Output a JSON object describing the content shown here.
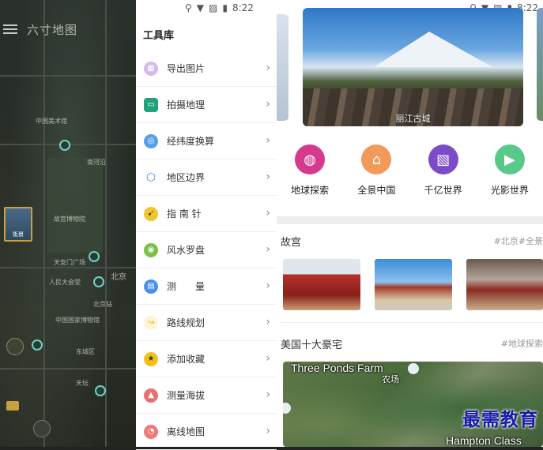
{
  "status_bar": {
    "time": "8:22"
  },
  "map": {
    "title": "六寸地图",
    "thumb_label": "街景",
    "place_labels": [
      "中国美术馆",
      "故宫博物院",
      "天安门广场",
      "北京",
      "人民大会堂",
      "北京站",
      "天坛",
      "南河沿",
      "东城区",
      "中国国家博物馆"
    ]
  },
  "toolbox": {
    "title": "工具库",
    "items": [
      {
        "label": "导出图片",
        "icon": "image-export-icon",
        "color": "#d5b8ee"
      },
      {
        "label": "拍摄地理",
        "icon": "camera-geo-icon",
        "color": "#1fa37a"
      },
      {
        "label": "经纬度换算",
        "icon": "latlng-convert-icon",
        "color": "#5aa0e6"
      },
      {
        "label": "地区边界",
        "icon": "boundary-icon",
        "color": "#3a8fd8"
      },
      {
        "label": "指 南 针",
        "icon": "compass-icon",
        "color": "#f2c530"
      },
      {
        "label": "风水罗盘",
        "icon": "fengshui-compass-icon",
        "color": "#7cc04a"
      },
      {
        "label": "测　　量",
        "icon": "measure-icon",
        "color": "#4a8ff0"
      },
      {
        "label": "路线规划",
        "icon": "route-plan-icon",
        "color": "#f0b030"
      },
      {
        "label": "添加收藏",
        "icon": "star-icon",
        "color": "#f2c21a"
      },
      {
        "label": "测量海拔",
        "icon": "altitude-icon",
        "color": "#e87070"
      },
      {
        "label": "离线地图",
        "icon": "offline-map-icon",
        "color": "#f07a7a"
      }
    ]
  },
  "feed": {
    "banner_caption": "丽江古城",
    "categories": [
      {
        "label": "地球探索",
        "icon": "globe-icon",
        "color": "#d63a8c"
      },
      {
        "label": "全景中国",
        "icon": "panorama-china-icon",
        "color": "#f29a5a"
      },
      {
        "label": "千亿世界",
        "icon": "world-photo-icon",
        "color": "#7c4cc8"
      },
      {
        "label": "光影世界",
        "icon": "tv-icon",
        "color": "#5ac88a"
      }
    ],
    "section1": {
      "title": "故宫",
      "tag": "#北京#全景"
    },
    "section2": {
      "title": "美国十大豪宅",
      "tag": "#地球探索"
    },
    "aerial": {
      "place": "Three Ponds Farm",
      "place_cn": "农场",
      "bottom": "Hampton Class"
    },
    "watermark": "最需教育"
  }
}
